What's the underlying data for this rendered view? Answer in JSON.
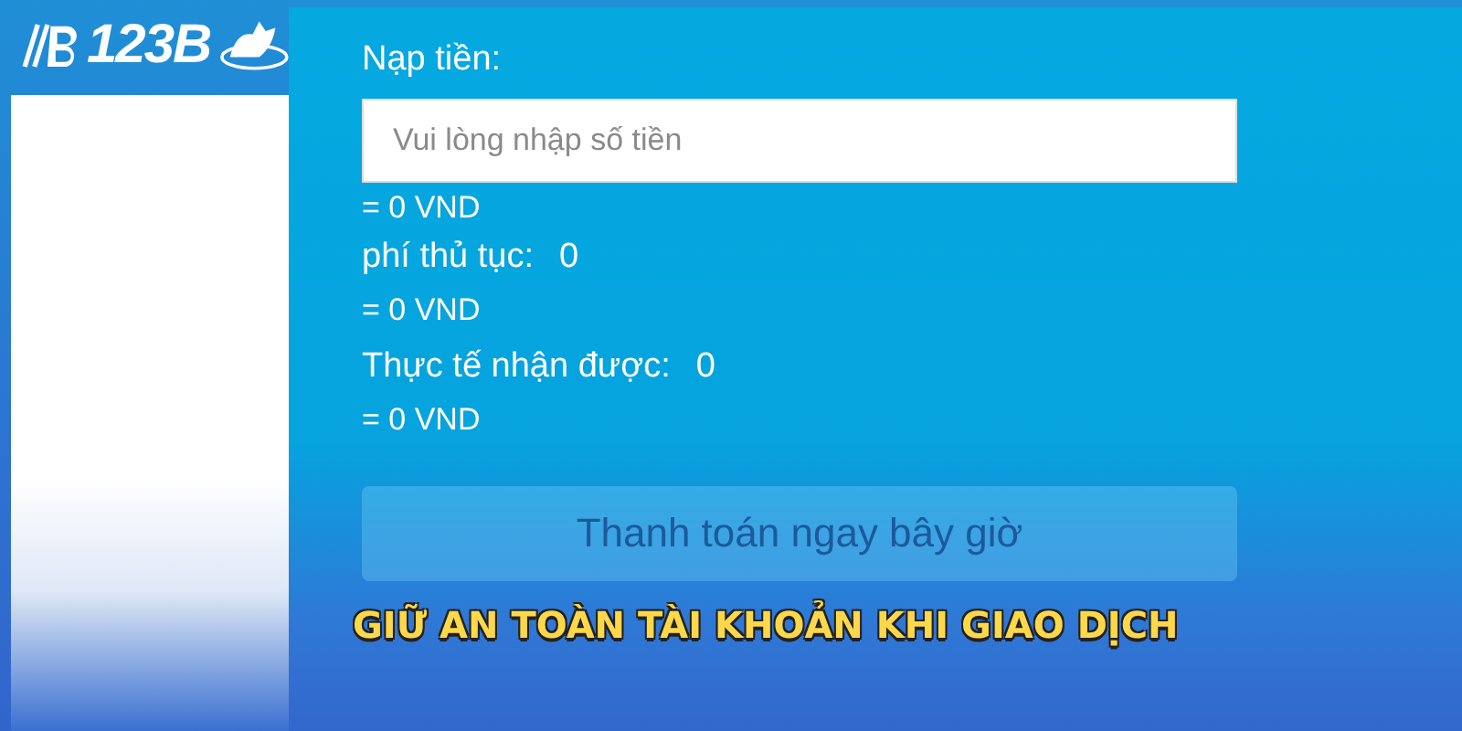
{
  "logo": {
    "text": "123B"
  },
  "deposit": {
    "label": "Nạp tiền:",
    "placeholder": "Vui lòng nhập số tiền",
    "converted": "= 0 VND"
  },
  "fees": [
    {
      "label": "phí thủ tục:",
      "value": "0",
      "converted": "= 0 VND"
    },
    {
      "label": "Thực tế nhận được:",
      "value": "0",
      "converted": "= 0 VND"
    }
  ],
  "pay_button": {
    "label": "Thanh toán ngay bây giờ",
    "disabled": true
  },
  "caption": "GIỮ AN TOÀN TÀI KHOẢN KHI GIAO DỊCH"
}
